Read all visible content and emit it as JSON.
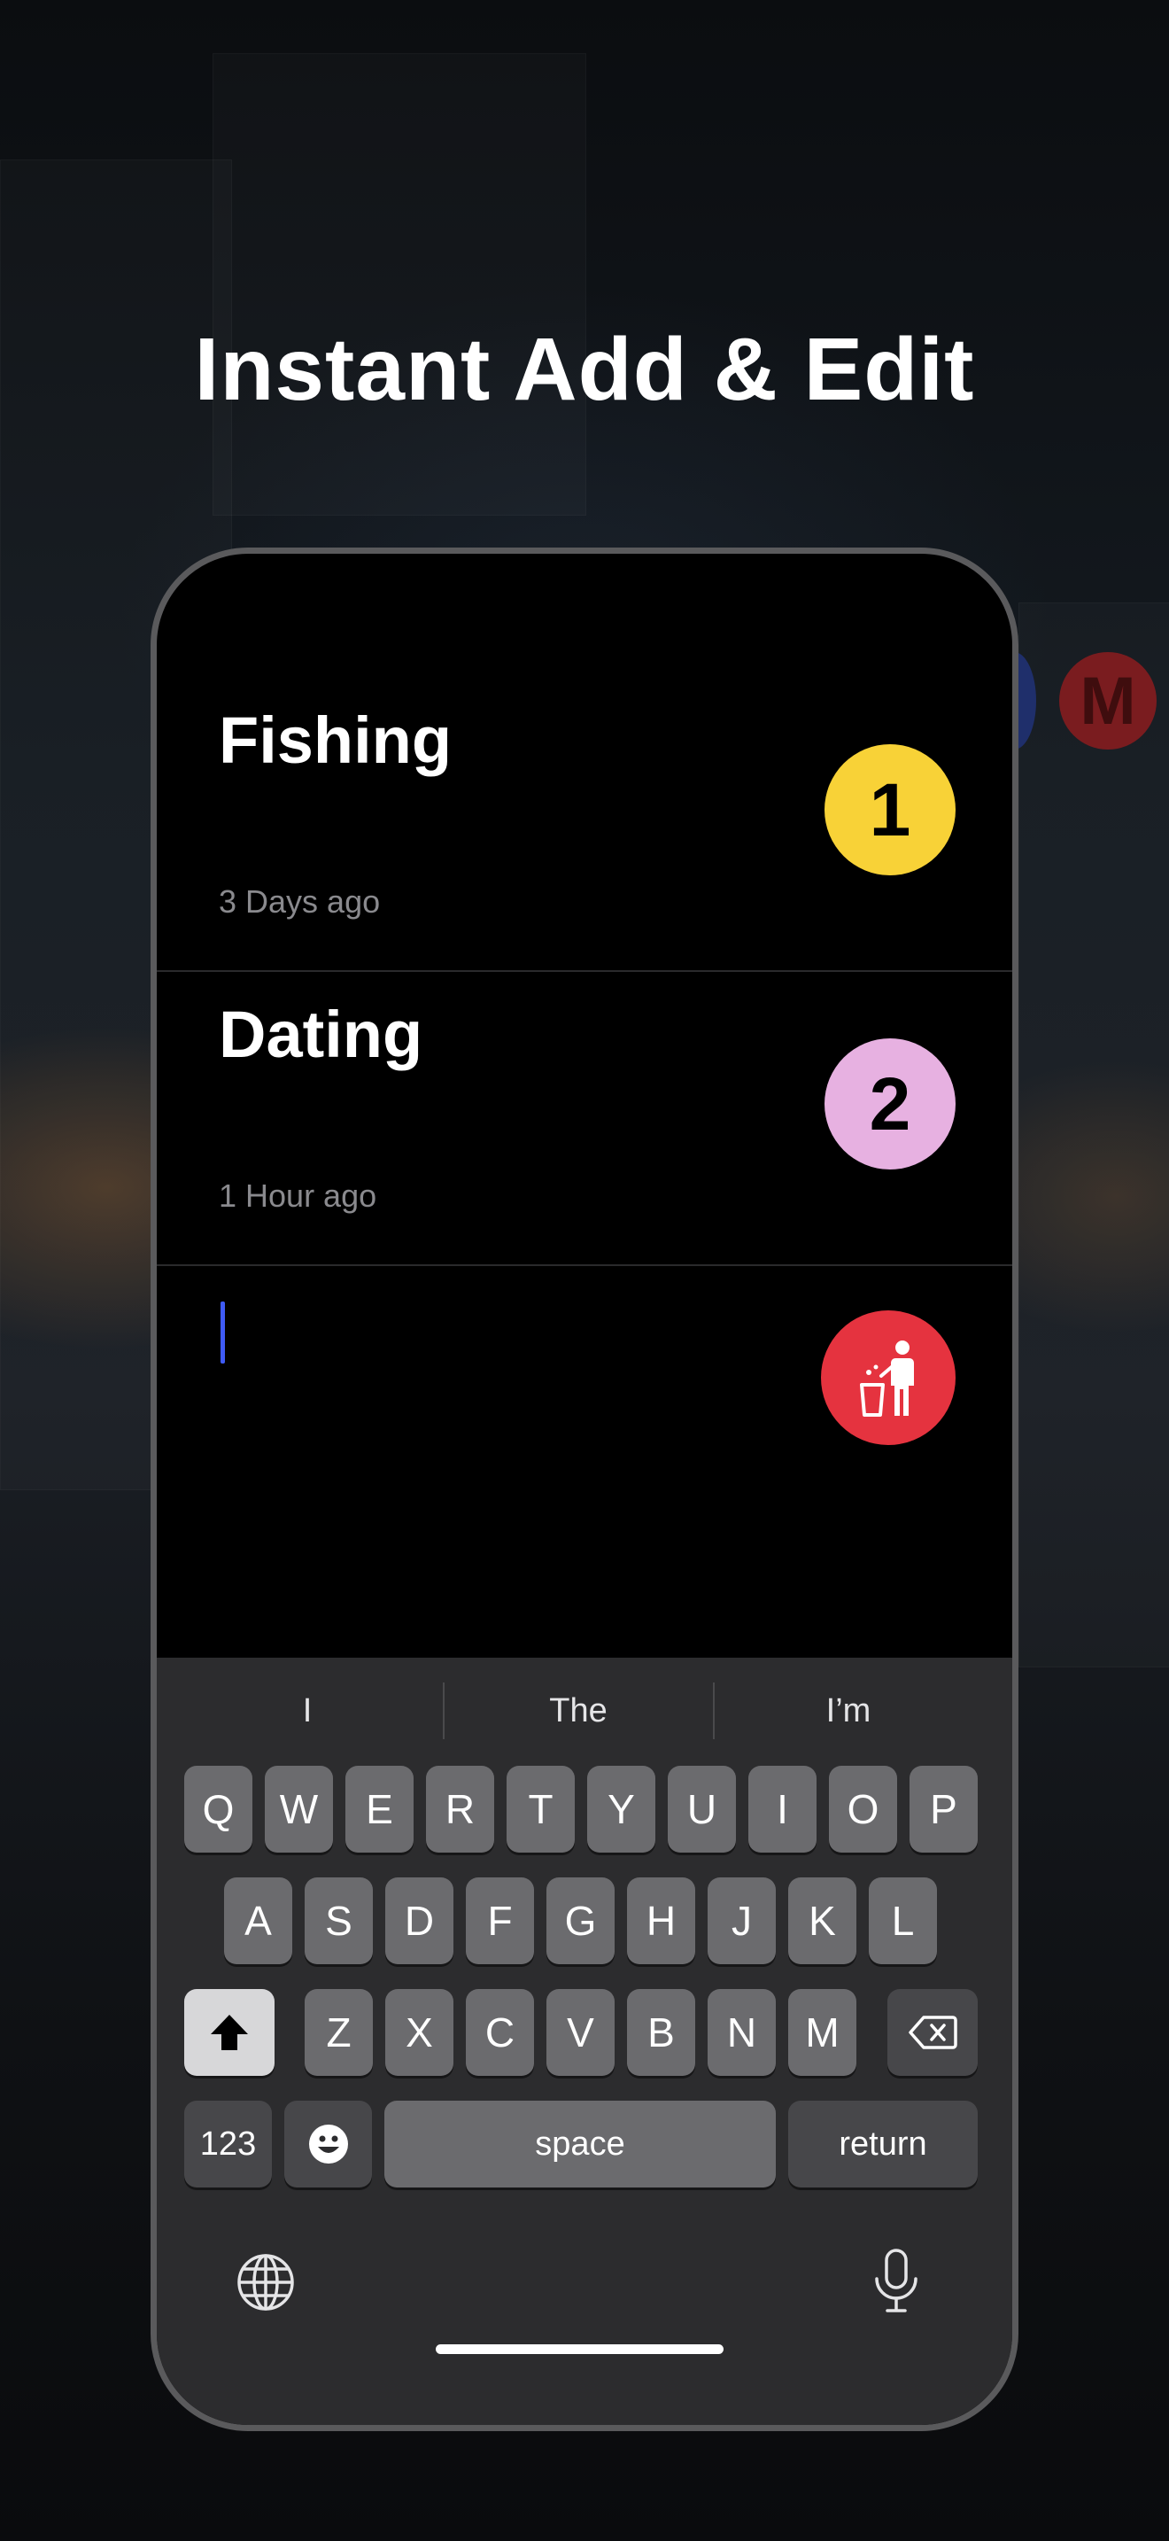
{
  "headline": "Instant Add & Edit",
  "background": {
    "metro_sign": "M"
  },
  "entries": [
    {
      "title": "Fishing",
      "meta": "3 Days ago",
      "badge": "1",
      "badge_color": "#f8d237"
    },
    {
      "title": "Dating",
      "meta": "1 Hour ago",
      "badge": "2",
      "badge_color": "#e7b1e1"
    }
  ],
  "new_entry": {
    "value": "",
    "delete_color": "#e5333f",
    "delete_icon": "trash-person-icon"
  },
  "keyboard": {
    "suggestions": [
      "I",
      "The",
      "I’m"
    ],
    "row1": [
      "Q",
      "W",
      "E",
      "R",
      "T",
      "Y",
      "U",
      "I",
      "O",
      "P"
    ],
    "row2": [
      "A",
      "S",
      "D",
      "F",
      "G",
      "H",
      "J",
      "K",
      "L"
    ],
    "row3": [
      "Z",
      "X",
      "C",
      "V",
      "B",
      "N",
      "M"
    ],
    "numbers_label": "123",
    "space_label": "space",
    "return_label": "return",
    "icons": {
      "shift": "shift-icon",
      "backspace": "backspace-icon",
      "emoji": "emoji-icon",
      "globe": "globe-icon",
      "dictation": "microphone-icon"
    }
  }
}
